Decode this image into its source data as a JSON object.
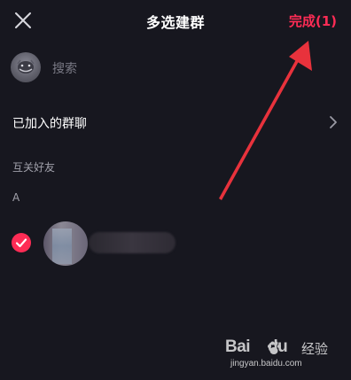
{
  "header": {
    "title": "多选建群",
    "done_label": "完成(1)"
  },
  "search": {
    "placeholder": "搜索"
  },
  "groups": {
    "label": "已加入的群聊"
  },
  "friends_section": {
    "label": "互关好友",
    "index": "A",
    "items": [
      {
        "selected": true
      }
    ]
  },
  "watermark": {
    "brand": "Bai",
    "brand2": "du",
    "suffix": "经验",
    "url": "jingyan.baidu.com"
  },
  "colors": {
    "background": "#17171f",
    "accent": "#fe2c55",
    "text_primary": "#ffffff",
    "text_secondary": "#a0a0aa",
    "annotation_arrow": "#e8323c"
  },
  "icons": {
    "close": "close-icon",
    "chevron": "chevron-right-icon",
    "check": "check-icon"
  }
}
